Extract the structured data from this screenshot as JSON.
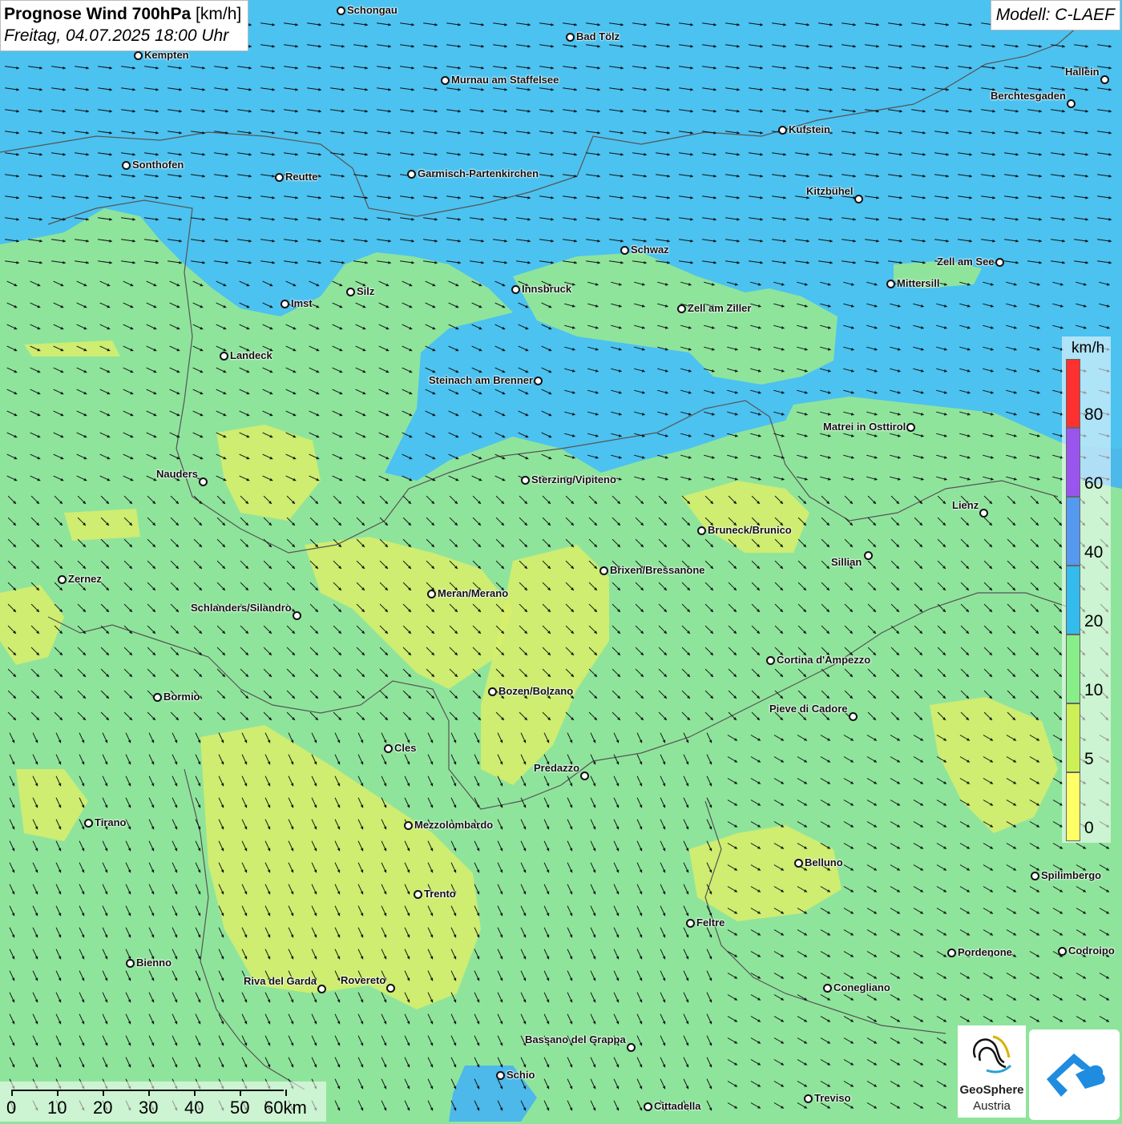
{
  "header": {
    "title_bold": "Prognose Wind 700hPa",
    "title_unit": "[km/h]",
    "subtitle": "Freitag, 04.07.2025 18:00 Uhr",
    "model": "Modell: C-LAEF"
  },
  "legend": {
    "unit": "km/h",
    "ticks": [
      "80",
      "60",
      "40",
      "20",
      "10",
      "5",
      "0"
    ],
    "colors": [
      "#ff3030",
      "#9955ee",
      "#5599f0",
      "#33bbee",
      "#88ee88",
      "#ccf055",
      "#ffff66"
    ]
  },
  "scale_bar": {
    "labels": [
      "0",
      "10",
      "20",
      "30",
      "40",
      "50",
      "60km"
    ]
  },
  "colors": {
    "zone_strong": "#4cc2f0",
    "zone_medium": "#4db8ea",
    "zone_light": "#8fe49c",
    "zone_calm": "#d9ee6a",
    "arrow": "#111111"
  },
  "cities": [
    {
      "name": "Schongau"
    },
    {
      "name": "Bad Tölz"
    },
    {
      "name": "Kempten"
    },
    {
      "name": "Murnau am Staffelsee"
    },
    {
      "name": "Hallein"
    },
    {
      "name": "Berchtesgaden"
    },
    {
      "name": "Kufstein"
    },
    {
      "name": "Sonthofen"
    },
    {
      "name": "Reutte"
    },
    {
      "name": "Garmisch-Partenkirchen"
    },
    {
      "name": "Kitzbühel"
    },
    {
      "name": "Schwaz"
    },
    {
      "name": "Zell am See"
    },
    {
      "name": "Mittersill"
    },
    {
      "name": "Innsbruck"
    },
    {
      "name": "Silz"
    },
    {
      "name": "Imst"
    },
    {
      "name": "Zell am Ziller"
    },
    {
      "name": "Landeck"
    },
    {
      "name": "Steinach am Brenner"
    },
    {
      "name": "Matrei in Osttirol"
    },
    {
      "name": "Nauders"
    },
    {
      "name": "Sterzing/Vipiteno"
    },
    {
      "name": "Lienz"
    },
    {
      "name": "Bruneck/Brunico"
    },
    {
      "name": "Sillian"
    },
    {
      "name": "Zernez"
    },
    {
      "name": "Brixen/Bressanone"
    },
    {
      "name": "Meran/Merano"
    },
    {
      "name": "Schlanders/Silandro"
    },
    {
      "name": "Cortina d'Ampezzo"
    },
    {
      "name": "Bozen/Bolzano"
    },
    {
      "name": "Bormio"
    },
    {
      "name": "Pieve di Cadore"
    },
    {
      "name": "Cles"
    },
    {
      "name": "Predazzo"
    },
    {
      "name": "Tirano"
    },
    {
      "name": "Mezzolombardo"
    },
    {
      "name": "Belluno"
    },
    {
      "name": "Spilimbergo"
    },
    {
      "name": "Trento"
    },
    {
      "name": "Feltre"
    },
    {
      "name": "Bienno"
    },
    {
      "name": "Pordenone"
    },
    {
      "name": "Codroipo"
    },
    {
      "name": "Riva del Garda"
    },
    {
      "name": "Rovereto"
    },
    {
      "name": "Conegliano"
    },
    {
      "name": "Bassano del Grappa"
    },
    {
      "name": "Schio"
    },
    {
      "name": "Treviso"
    },
    {
      "name": "Cittadella"
    }
  ],
  "logo": {
    "name": "GeoSphere",
    "sub": "Austria"
  }
}
